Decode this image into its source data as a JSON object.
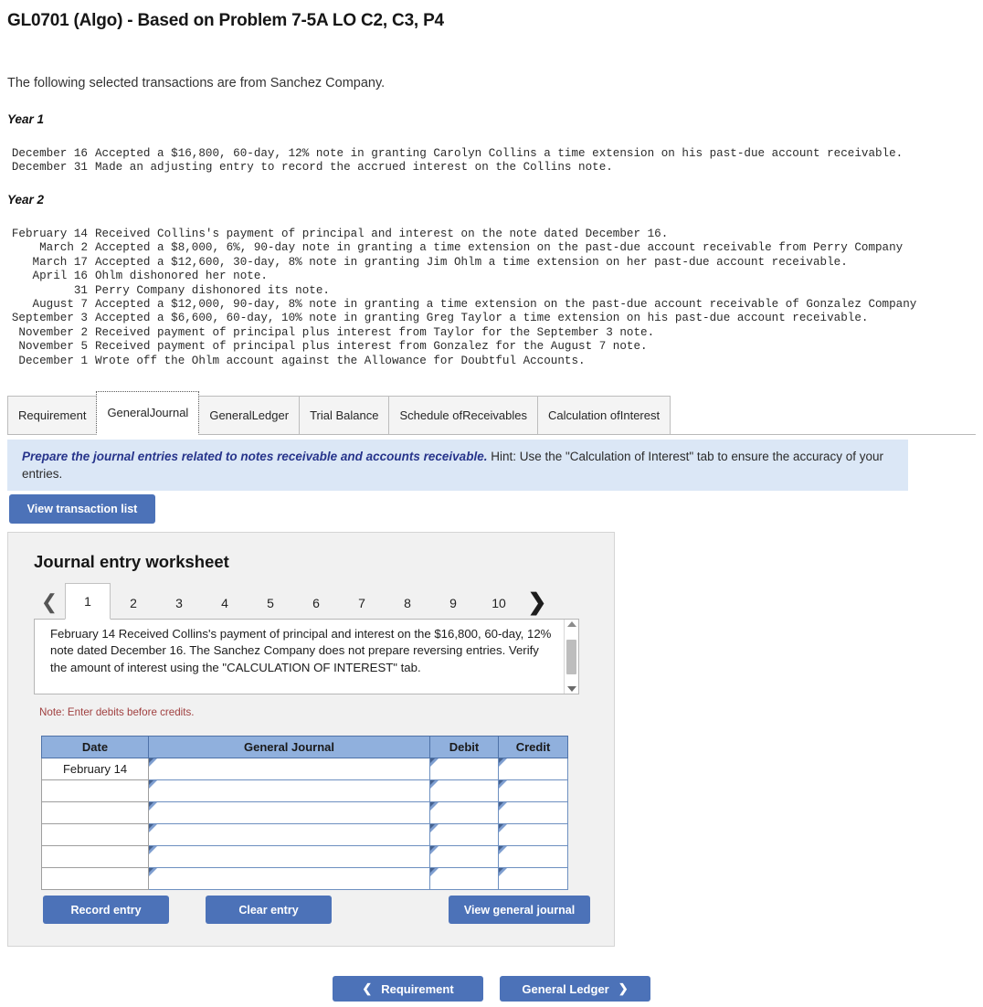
{
  "header": {
    "title": "GL0701 (Algo) - Based on Problem 7-5A LO C2, C3, P4",
    "intro": "The following selected transactions are from Sanchez Company."
  },
  "transactions": {
    "year1_label": "Year 1",
    "year2_label": "Year 2",
    "year1": [
      {
        "date": "December 16",
        "desc": "Accepted a $16,800, 60-day, 12% note in granting Carolyn Collins a time extension on his past-due account receivable."
      },
      {
        "date": "December 31",
        "desc": "Made an adjusting entry to record the accrued interest on the Collins note."
      }
    ],
    "year2": [
      {
        "date": "February 14",
        "desc": "Received Collins's payment of principal and interest on the note dated December 16."
      },
      {
        "date": "March 2",
        "desc": "Accepted a $8,000, 6%, 90-day note in granting a time extension on the past-due account receivable from Perry Company"
      },
      {
        "date": "March 17",
        "desc": "Accepted a $12,600, 30-day, 8% note in granting Jim Ohlm a time extension on her past-due account receivable."
      },
      {
        "date": "April 16",
        "desc": "Ohlm dishonored her note."
      },
      {
        "date": "31",
        "desc": "Perry Company dishonored its note."
      },
      {
        "date": "August 7",
        "desc": "Accepted a $12,000, 90-day, 8% note in granting a time extension on the past-due account receivable of Gonzalez Company"
      },
      {
        "date": "September 3",
        "desc": "Accepted a $6,600, 60-day, 10% note in granting Greg Taylor a time extension on his past-due account receivable."
      },
      {
        "date": "November 2",
        "desc": "Received payment of principal plus interest from Taylor for the September 3 note."
      },
      {
        "date": "November 5",
        "desc": "Received payment of principal plus interest from Gonzalez for the August 7 note."
      },
      {
        "date": "December 1",
        "desc": "Wrote off the Ohlm account against the Allowance for Doubtful Accounts."
      }
    ]
  },
  "tabs": [
    {
      "label": "Requirement",
      "active": false
    },
    {
      "label": "General\nJournal",
      "line1": "General",
      "line2": "Journal",
      "active": true
    },
    {
      "label": "General\nLedger",
      "line1": "General",
      "line2": "Ledger",
      "active": false
    },
    {
      "label": "Trial Balance",
      "line1": "Trial Balance",
      "line2": "",
      "active": false
    },
    {
      "label": "Schedule of\nReceivables",
      "line1": "Schedule of",
      "line2": "Receivables",
      "active": false
    },
    {
      "label": "Calculation of\nInterest",
      "line1": "Calculation of",
      "line2": "Interest",
      "active": false
    }
  ],
  "requirement_banner": {
    "bold": "Prepare the journal entries related to notes receivable and accounts receivable.",
    "rest": " Hint:  Use the \"Calculation of Interest\" tab to ensure the accuracy of your entries."
  },
  "buttons": {
    "view_transaction_list": "View transaction list",
    "record_entry": "Record entry",
    "clear_entry": "Clear entry",
    "view_general_journal": "View general journal",
    "nav_prev": "Requirement",
    "nav_next": "General Ledger",
    "prev_chevron": "❮",
    "next_chevron": "❯"
  },
  "worksheet": {
    "title": "Journal entry worksheet",
    "pages": [
      "1",
      "2",
      "3",
      "4",
      "5",
      "6",
      "7",
      "8",
      "9",
      "10"
    ],
    "active_page": "1",
    "prev_arrow": "❮",
    "next_arrow": "❯",
    "instruction": "February 14 Received Collins's payment of principal and interest on the $16,800, 60-day, 12% note dated December 16. The Sanchez Company does not prepare reversing entries. Verify the amount of interest using the \"CALCULATION OF INTEREST\" tab.",
    "note": "Note: Enter debits before credits.",
    "table": {
      "headers": [
        "Date",
        "General Journal",
        "Debit",
        "Credit"
      ],
      "rows": [
        {
          "date": "February 14",
          "journal": "",
          "debit": "",
          "credit": ""
        },
        {
          "date": "",
          "journal": "",
          "debit": "",
          "credit": ""
        },
        {
          "date": "",
          "journal": "",
          "debit": "",
          "credit": ""
        },
        {
          "date": "",
          "journal": "",
          "debit": "",
          "credit": ""
        },
        {
          "date": "",
          "journal": "",
          "debit": "",
          "credit": ""
        },
        {
          "date": "",
          "journal": "",
          "debit": "",
          "credit": ""
        }
      ]
    }
  },
  "colors": {
    "button_blue": "#4c72b8",
    "banner_blue": "#dbe7f6",
    "table_header_blue": "#90b0dd",
    "panel_grey": "#f1f1f1",
    "note_red": "#a04040",
    "requirement_bold": "#27348b"
  }
}
